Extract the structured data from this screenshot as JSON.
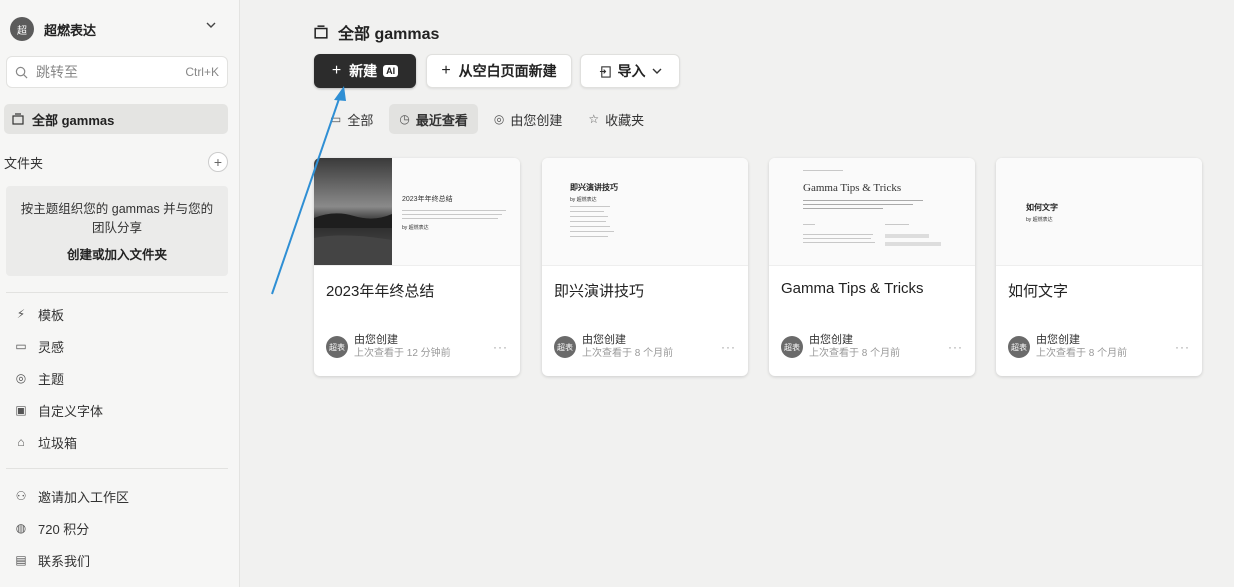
{
  "sidebar": {
    "workspace": {
      "avatar": "超",
      "name": "超燃表达"
    },
    "search": {
      "placeholder": "跳转至",
      "shortcut": "Ctrl+K"
    },
    "all_gammas": "全部 gammas",
    "folders": {
      "title": "文件夹",
      "add": "+",
      "description": "按主题组织您的 gammas 并与您的团队分享",
      "create_link": "创建或加入文件夹"
    },
    "nav_items": [
      {
        "label": "模板",
        "icon": "templates-icon"
      },
      {
        "label": "灵感",
        "icon": "inspiration-icon"
      },
      {
        "label": "主题",
        "icon": "palette-icon"
      },
      {
        "label": "自定义字体",
        "icon": "font-icon"
      },
      {
        "label": "垃圾箱",
        "icon": "trash-icon"
      }
    ],
    "bottom_items": [
      {
        "label": "邀请加入工作区",
        "icon": "invite-icon"
      },
      {
        "label": "720 积分",
        "icon": "credits-icon"
      },
      {
        "label": "联系我们",
        "icon": "contact-icon"
      }
    ]
  },
  "main": {
    "title": "全部 gammas",
    "buttons": {
      "new": "新建",
      "ai_badge": "AI",
      "blank": "从空白页面新建",
      "import": "导入"
    },
    "tabs": [
      {
        "label": "全部",
        "icon": "grid-icon"
      },
      {
        "label": "最近查看",
        "icon": "clock-icon"
      },
      {
        "label": "由您创建",
        "icon": "user-icon"
      },
      {
        "label": "收藏夹",
        "icon": "star-icon"
      }
    ],
    "active_tab": "最近查看",
    "cards": [
      {
        "title": "2023年年终总结",
        "thumb_title": "2023年年终总结",
        "thumb_author": "by 超燃表达",
        "by": "由您创建",
        "time": "上次查看于 12 分钟前",
        "avatar": "超表"
      },
      {
        "title": "即兴演讲技巧",
        "thumb_title": "即兴演讲技巧",
        "thumb_author": "by 超燃表达",
        "by": "由您创建",
        "time": "上次查看于 8 个月前",
        "avatar": "超表"
      },
      {
        "title": "Gamma Tips & Tricks",
        "thumb_title": "Gamma Tips & Tricks",
        "thumb_author": "",
        "by": "由您创建",
        "time": "上次查看于 8 个月前",
        "avatar": "超表"
      },
      {
        "title": "如何文字",
        "thumb_title": "如何文字",
        "thumb_author": "by 超燃表达",
        "by": "由您创建",
        "time": "上次查看于 8 个月前",
        "avatar": "超表"
      }
    ],
    "more_label": "···"
  },
  "colors": {
    "primary_button": "#2c2c2c",
    "annotation_arrow": "#2f8fd4"
  }
}
